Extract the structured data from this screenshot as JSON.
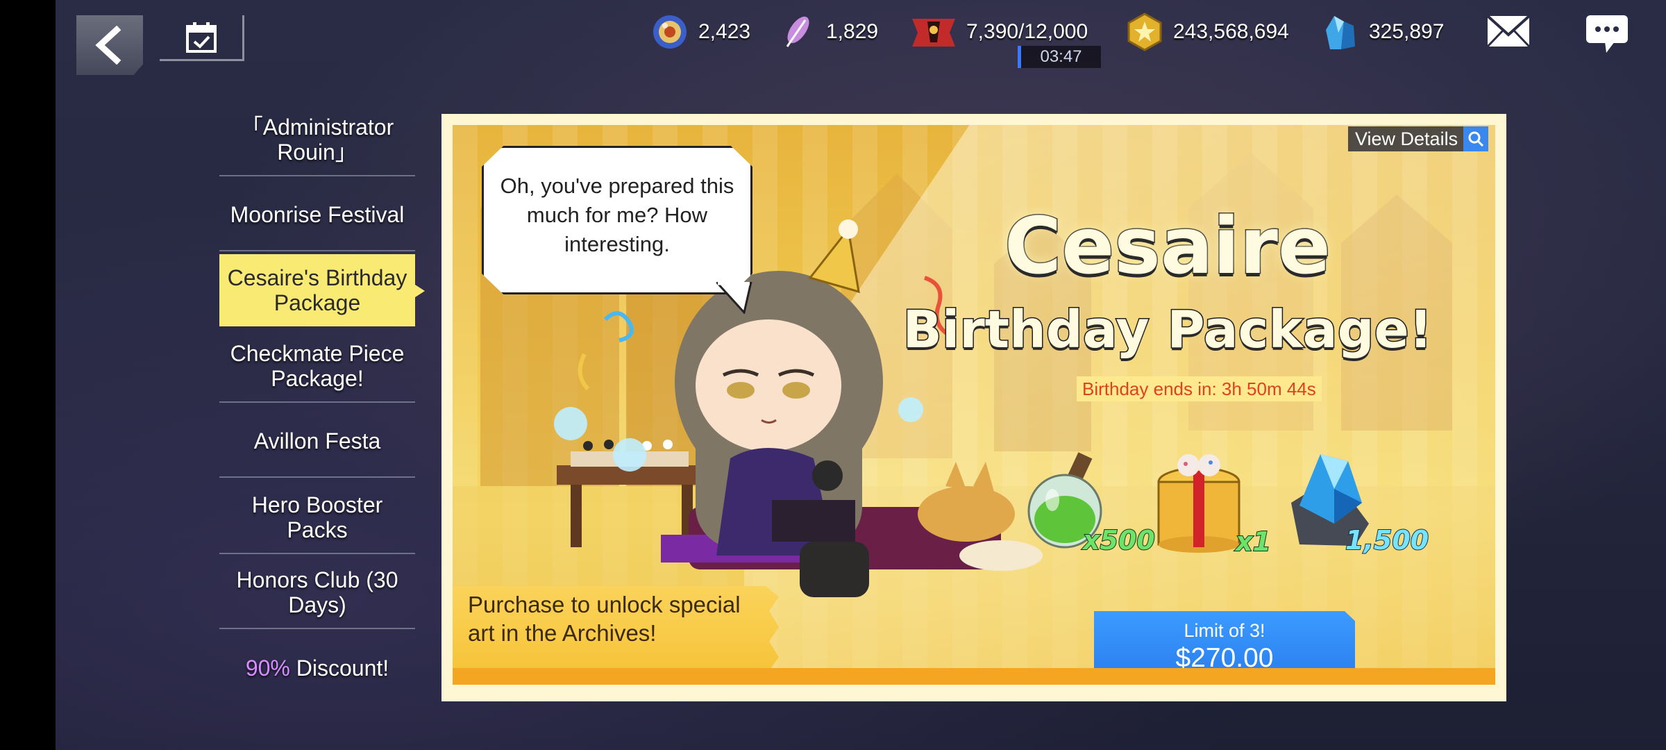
{
  "top_bar": {
    "resources": [
      {
        "icon": "crystal-orb-icon",
        "value": "2,423"
      },
      {
        "icon": "feather-quill-icon",
        "value": "1,829"
      },
      {
        "icon": "stamina-banner-icon",
        "value": "7,390/12,000"
      },
      {
        "icon": "gold-coin-icon",
        "value": "243,568,694"
      },
      {
        "icon": "blue-crystal-icon",
        "value": "325,897"
      }
    ],
    "stamina_timer": "03:47",
    "icons": [
      "back-arrow-icon",
      "calendar-check-icon",
      "mail-icon",
      "chat-bubble-icon"
    ]
  },
  "sidebar": {
    "items": [
      {
        "label": "「Administrator Rouin」",
        "active": false
      },
      {
        "label": "Moonrise Festival",
        "active": false
      },
      {
        "label": "Cesaire's Birthday Package",
        "active": true
      },
      {
        "label": "Checkmate Piece Package!",
        "active": false
      },
      {
        "label": "Avillon Festa",
        "active": false
      },
      {
        "label": "Hero Booster Packs",
        "active": false
      },
      {
        "label": "Honors Club (30 Days)",
        "active": false
      }
    ],
    "discount_item": {
      "percent": "90%",
      "label": " Discount!"
    }
  },
  "banner": {
    "view_details": "View Details",
    "speech": "Oh, you've prepared this much for me? How interesting.",
    "title_line1": "Cesaire",
    "title_line2": "Birthday Package!",
    "countdown": "Birthday ends in: 3h 50m 44s",
    "rewards": [
      {
        "icon": "green-potion-icon",
        "qty": "x500"
      },
      {
        "icon": "gift-box-icon",
        "qty": "x1"
      },
      {
        "icon": "blue-ore-icon",
        "qty": "1,500"
      }
    ],
    "buy": {
      "limit": "Limit of 3!",
      "price": "$270.00"
    },
    "unlock_note": "Purchase to unlock special art in the Archives!"
  },
  "colors": {
    "active_tab": "#f9ea74",
    "buy_button": "#2a7dee",
    "countdown_text": "#e0411f",
    "discount_percent": "#d78cff",
    "banner_frame": "#f4a521"
  }
}
